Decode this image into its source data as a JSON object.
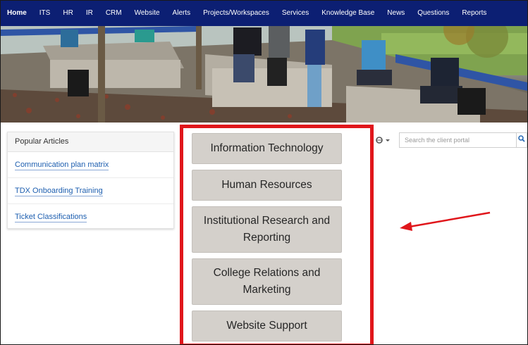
{
  "nav": {
    "items": [
      "Home",
      "ITS",
      "HR",
      "IR",
      "CRM",
      "Website",
      "Alerts",
      "Projects/Workspaces",
      "Services",
      "Knowledge Base",
      "News",
      "Questions",
      "Reports"
    ]
  },
  "popular": {
    "title": "Popular Articles",
    "items": [
      "Communication plan matrix",
      "TDX Onboarding Training",
      "Ticket Classifications"
    ]
  },
  "services": {
    "buttons": [
      "Information Technology",
      "Human Resources",
      "Institutional Research and Reporting",
      "College Relations and Marketing",
      "Website Support"
    ]
  },
  "search": {
    "placeholder": "Search the client portal",
    "globe_icon": "globe-icon",
    "search_icon": "search-icon"
  },
  "colors": {
    "nav_bg": "#0c1f73",
    "highlight": "#e0161b",
    "button_bg": "#d4d0cb",
    "link": "#1e5fb0"
  }
}
